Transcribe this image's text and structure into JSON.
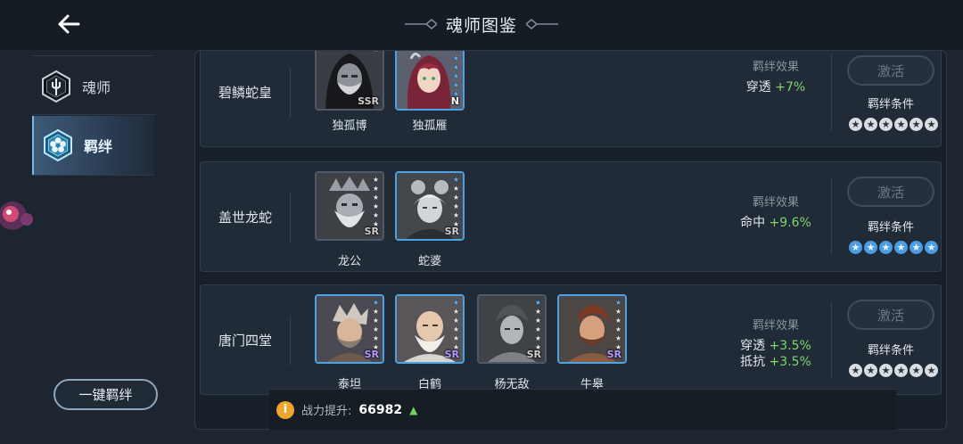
{
  "header": {
    "title": "魂师图鉴"
  },
  "sidebar": {
    "items": [
      {
        "label": "魂师",
        "icon": "trident-icon",
        "active": false
      },
      {
        "label": "羁绊",
        "icon": "flower-icon",
        "active": true
      }
    ],
    "one_key_button": "一键羁绊"
  },
  "rows": [
    {
      "name": "碧鳞蛇皇",
      "effect_label": "羁绊效果",
      "effects": [
        {
          "stat": "穿透",
          "value": "+7%"
        }
      ],
      "activate_label": "激活",
      "condition_label": "羁绊条件",
      "condition_stars": [
        "white",
        "white",
        "white",
        "white",
        "white",
        "white"
      ],
      "cards": [
        {
          "name": "独孤博",
          "rarity": "SSR",
          "border": "gray",
          "stars": [
            "white"
          ]
        },
        {
          "name": "独孤雁",
          "rarity": "N",
          "border": "blue",
          "stars": [
            "blue",
            "blue",
            "blue",
            "blue",
            "blue",
            "blue"
          ]
        }
      ]
    },
    {
      "name": "盖世龙蛇",
      "effect_label": "羁绊效果",
      "effects": [
        {
          "stat": "命中",
          "value": "+9.6%"
        }
      ],
      "activate_label": "激活",
      "condition_label": "羁绊条件",
      "condition_stars": [
        "blue",
        "blue",
        "blue",
        "blue",
        "blue",
        "blue"
      ],
      "cards": [
        {
          "name": "龙公",
          "rarity": "SR",
          "border": "gray",
          "stars": [
            "white",
            "white",
            "white",
            "white",
            "white",
            "white"
          ]
        },
        {
          "name": "蛇婆",
          "rarity": "SR",
          "border": "blue",
          "stars": [
            "blue",
            "white",
            "white",
            "white",
            "white",
            "white"
          ]
        }
      ]
    },
    {
      "name": "唐门四堂",
      "effect_label": "羁绊效果",
      "effects": [
        {
          "stat": "穿透",
          "value": "+3.5%"
        },
        {
          "stat": "抵抗",
          "value": "+3.5%"
        }
      ],
      "activate_label": "激活",
      "condition_label": "羁绊条件",
      "condition_stars": [
        "white",
        "white",
        "white",
        "white",
        "white",
        "white"
      ],
      "cards": [
        {
          "name": "泰坦",
          "rarity": "SR",
          "border": "blue",
          "stars": [
            "blue",
            "white",
            "white",
            "white",
            "white",
            "white"
          ]
        },
        {
          "name": "白鹤",
          "rarity": "SR",
          "border": "blue",
          "stars": [
            "blue",
            "white",
            "white",
            "white",
            "white",
            "white"
          ]
        },
        {
          "name": "杨无敌",
          "rarity": "SR",
          "border": "gray",
          "stars": [
            "blue",
            "white",
            "white",
            "white",
            "white",
            "white"
          ]
        },
        {
          "name": "牛皋",
          "rarity": "SR",
          "border": "blue",
          "stars": [
            "blue",
            "white",
            "white",
            "white",
            "white",
            "white"
          ]
        }
      ]
    }
  ],
  "bottom_bar": {
    "label": "战力提升:",
    "value": "66982"
  }
}
